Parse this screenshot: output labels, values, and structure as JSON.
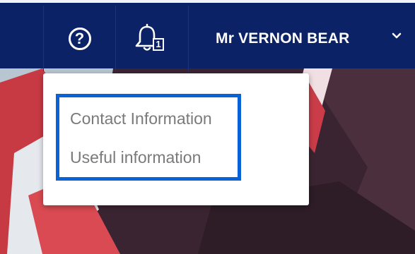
{
  "header": {
    "help_icon": "help-circle-icon",
    "help_glyph": "?",
    "notifications": {
      "icon": "bell-icon",
      "count": "1"
    },
    "user": {
      "name": "Mr VERNON BEAR",
      "chevron_icon": "chevron-down-icon"
    }
  },
  "dropdown": {
    "items": [
      {
        "label": "Contact Information"
      },
      {
        "label": "Useful information"
      }
    ]
  },
  "colors": {
    "navbar": "#0b2266",
    "highlight_border": "#0a63d6",
    "menu_text": "#7a7a7a"
  }
}
